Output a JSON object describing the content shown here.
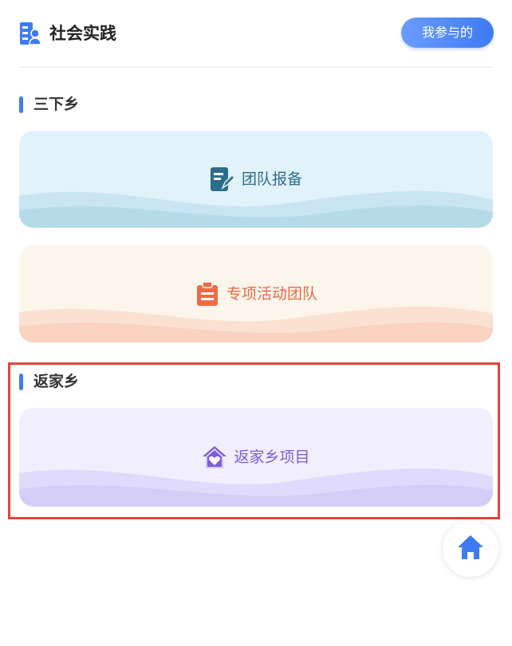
{
  "header": {
    "title": "社会实践",
    "my_participation_label": "我参与的",
    "icon": "practice-icon"
  },
  "sections": [
    {
      "title": "三下乡",
      "cards": [
        {
          "label": "团队报备",
          "icon": "edit-note-icon",
          "color": "#2b6e8a"
        },
        {
          "label": "专项活动团队",
          "icon": "clipboard-icon",
          "color": "#e86a47"
        }
      ]
    },
    {
      "title": "返家乡",
      "cards": [
        {
          "label": "返家乡项目",
          "icon": "home-heart-icon",
          "color": "#7d5cd8"
        }
      ]
    }
  ],
  "fab": {
    "icon": "home-icon"
  },
  "colors": {
    "accent": "#3e7bf2",
    "highlight": "#e0453a"
  }
}
